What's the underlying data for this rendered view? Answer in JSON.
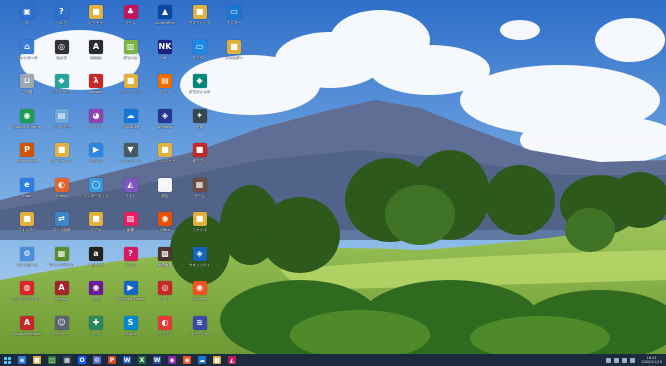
{
  "desktop": {
    "icons": [
      {
        "label": "PC",
        "color": "#2c6fd1",
        "symbol": "▣",
        "icon": "this-pc-icon"
      },
      {
        "label": "ネットワーク",
        "color": "#3a7bd5",
        "symbol": "⌂",
        "icon": "network-icon"
      },
      {
        "label": "ごみ箱",
        "color": "#a0a8b3",
        "symbol": "⊔",
        "icon": "recycle-bin-icon"
      },
      {
        "label": "Google Chrome",
        "color": "#1f9d55",
        "symbol": "◉",
        "icon": "chrome-icon"
      },
      {
        "label": "PowerPoint",
        "color": "#d35400",
        "symbol": "P",
        "icon": "powerpoint-icon"
      },
      {
        "label": "Edge",
        "color": "#2f7de1",
        "symbol": "e",
        "icon": "edge-icon"
      },
      {
        "label": "フォルダー",
        "color": "#e0b13d",
        "symbol": "■",
        "icon": "folder-icon"
      },
      {
        "label": "コントロール",
        "color": "#4a90d9",
        "symbol": "⚙",
        "icon": "control-panel-icon"
      },
      {
        "label": "ウイルスバスター",
        "color": "#d62828",
        "symbol": "◍",
        "icon": "antivirus-icon"
      },
      {
        "label": "Acrobat Reader",
        "color": "#c62828",
        "symbol": "A",
        "icon": "acrobat-icon"
      },
      {
        "label": "ヘルプ",
        "color": "#2f6fc7",
        "symbol": "?",
        "icon": "help-icon"
      },
      {
        "label": "カメラ",
        "color": "#333333",
        "symbol": "◎",
        "icon": "camera-icon"
      },
      {
        "label": "ソフトウェア",
        "color": "#26a69a",
        "symbol": "◆",
        "icon": "software-icon"
      },
      {
        "label": "フォルダー",
        "color": "#6fa8dc",
        "symbol": "▤",
        "icon": "folder-icon"
      },
      {
        "label": "ドキュメント",
        "color": "#e0b13d",
        "symbol": "■",
        "icon": "folder-icon"
      },
      {
        "label": "Firefox",
        "color": "#e8622c",
        "symbol": "◐",
        "icon": "firefox-icon"
      },
      {
        "label": "ネット接続",
        "color": "#3d85c6",
        "symbol": "⇄",
        "icon": "connection-icon"
      },
      {
        "label": "マインクラフト",
        "color": "#5b8c2a",
        "symbol": "▦",
        "icon": "game-icon"
      },
      {
        "label": "Access",
        "color": "#a4262c",
        "symbol": "A",
        "icon": "access-icon"
      },
      {
        "label": "ユーザー",
        "color": "#5a6470",
        "symbol": "☺",
        "icon": "user-icon"
      },
      {
        "label": "ピクチャ",
        "color": "#e0b13d",
        "symbol": "■",
        "icon": "folder-icon"
      },
      {
        "label": "Adobe",
        "color": "#2b2b2b",
        "symbol": "A",
        "icon": "adobe-icon"
      },
      {
        "label": "Acrobat",
        "color": "#c62828",
        "symbol": "λ",
        "icon": "acrobat-icon"
      },
      {
        "label": "ペイント",
        "color": "#8e44ad",
        "symbol": "◕",
        "icon": "paint-icon"
      },
      {
        "label": "メディア",
        "color": "#2e86de",
        "symbol": "▶",
        "icon": "media-icon"
      },
      {
        "label": "インターネット",
        "color": "#3498db",
        "symbol": "◯",
        "icon": "ie-icon"
      },
      {
        "label": "ビデオ",
        "color": "#e0b13d",
        "symbol": "■",
        "icon": "folder-icon"
      },
      {
        "label": "Amazon",
        "color": "#222222",
        "symbol": "a",
        "icon": "amazon-icon"
      },
      {
        "label": "DVD",
        "color": "#6a1b9a",
        "symbol": "◉",
        "icon": "dvd-icon"
      },
      {
        "label": "ツール",
        "color": "#2d8659",
        "symbol": "✚",
        "icon": "tools-icon"
      },
      {
        "label": "ゲーム",
        "color": "#c2185b",
        "symbol": "♣",
        "icon": "game-icon"
      },
      {
        "label": "グリーン",
        "color": "#7cb342",
        "symbol": "▥",
        "icon": "app-icon"
      },
      {
        "label": "ミュージック",
        "color": "#e0b13d",
        "symbol": "■",
        "icon": "folder-icon"
      },
      {
        "label": "OneDrive",
        "color": "#1976d2",
        "symbol": "☁",
        "icon": "onedrive-icon"
      },
      {
        "label": "インストール",
        "color": "#455a64",
        "symbol": "▼",
        "icon": "installer-icon"
      },
      {
        "label": "フォト",
        "color": "#7e57c2",
        "symbol": "◭",
        "icon": "photos-icon"
      },
      {
        "label": "画像",
        "color": "#e91e63",
        "symbol": "▧",
        "icon": "image-icon"
      },
      {
        "label": "ヘルプ",
        "color": "#d81b60",
        "symbol": "?",
        "icon": "help-icon"
      },
      {
        "label": "Windows Media",
        "color": "#1565c0",
        "symbol": "▶",
        "icon": "media-player-icon"
      },
      {
        "label": "Skype",
        "color": "#0288d1",
        "symbol": "S",
        "icon": "skype-icon"
      },
      {
        "label": "LibreOffice",
        "color": "#0d47a1",
        "symbol": "▲",
        "icon": "office-icon"
      },
      {
        "label": "NK",
        "color": "#1a237e",
        "symbol": "NK",
        "icon": "nk-icon"
      },
      {
        "label": "ソフト",
        "color": "#ef6c00",
        "symbol": "▤",
        "icon": "app-icon"
      },
      {
        "label": "Windows",
        "color": "#283593",
        "symbol": "◈",
        "icon": "windows-icon"
      },
      {
        "label": "ダウンロード",
        "color": "#e0b13d",
        "symbol": "■",
        "icon": "folder-icon"
      },
      {
        "label": "設定",
        "color": "#f5f5f5",
        "symbol": "⚙",
        "icon": "settings-icon"
      },
      {
        "label": "Office",
        "color": "#e65100",
        "symbol": "◉",
        "icon": "office-icon"
      },
      {
        "label": "画像編集",
        "color": "#4e342e",
        "symbol": "▩",
        "icon": "image-editor-icon"
      },
      {
        "label": "フォト",
        "color": "#c62828",
        "symbol": "◎",
        "icon": "photo-icon"
      },
      {
        "label": "ロックス",
        "color": "#e53935",
        "symbol": "◐",
        "icon": "app-icon"
      },
      {
        "label": "デスクトップ",
        "color": "#e0b13d",
        "symbol": "■",
        "icon": "folder-icon"
      },
      {
        "label": "モニター",
        "color": "#1e88e5",
        "symbol": "▭",
        "icon": "monitor-icon"
      },
      {
        "label": "グラフィック",
        "color": "#00897b",
        "symbol": "◆",
        "icon": "graphics-icon"
      },
      {
        "label": "写真",
        "color": "#37474f",
        "symbol": "✦",
        "icon": "photo-icon"
      },
      {
        "label": "赤アプリ",
        "color": "#c62828",
        "symbol": "■",
        "icon": "app-icon"
      },
      {
        "label": "ゲーム",
        "color": "#6d4c41",
        "symbol": "▦",
        "icon": "game-icon"
      },
      {
        "label": "ファイル",
        "color": "#e0b13d",
        "symbol": "■",
        "icon": "folder-icon"
      },
      {
        "label": "セキュリティ",
        "color": "#1565c0",
        "symbol": "◈",
        "icon": "security-icon"
      },
      {
        "label": "Chrome",
        "color": "#f4511e",
        "symbol": "◉",
        "icon": "chrome-icon"
      },
      {
        "label": "オーディオ",
        "color": "#3949ab",
        "symbol": "≋",
        "icon": "audio-icon"
      },
      {
        "label": "モニター",
        "color": "#1976d2",
        "symbol": "▭",
        "icon": "monitor-icon"
      },
      {
        "label": "フォルダー",
        "color": "#e0b13d",
        "symbol": "■",
        "icon": "folder-icon"
      }
    ]
  },
  "taskbar": {
    "apps": [
      {
        "icon": "edge-icon",
        "color": "#2f7de1",
        "symbol": "e"
      },
      {
        "icon": "file-explorer-icon",
        "color": "#e0b13d",
        "symbol": "■"
      },
      {
        "icon": "store-icon",
        "color": "#2e7d32",
        "symbol": "◫"
      },
      {
        "icon": "app-icon",
        "color": "#37474f",
        "symbol": "▦"
      },
      {
        "icon": "outlook-icon",
        "color": "#0f62fe",
        "symbol": "O"
      },
      {
        "icon": "settings-icon",
        "color": "#5c6bc0",
        "symbol": "⚙"
      },
      {
        "icon": "powerpoint-icon",
        "color": "#d24726",
        "symbol": "P"
      },
      {
        "icon": "word-icon",
        "color": "#1e5bb8",
        "symbol": "W"
      },
      {
        "icon": "excel-icon",
        "color": "#1d6f42",
        "symbol": "X"
      },
      {
        "icon": "word-icon",
        "color": "#2b579a",
        "symbol": "W"
      },
      {
        "icon": "media-icon",
        "color": "#8e24aa",
        "symbol": "◉"
      },
      {
        "icon": "chrome-icon",
        "color": "#f4511e",
        "symbol": "◉"
      },
      {
        "icon": "onedrive-icon",
        "color": "#1976d2",
        "symbol": "☁"
      },
      {
        "icon": "folder-icon",
        "color": "#e0b13d",
        "symbol": "■"
      },
      {
        "icon": "photos-icon",
        "color": "#c2185b",
        "symbol": "◭"
      }
    ],
    "clock_time": "16:41",
    "clock_date": "2020/11/10"
  }
}
